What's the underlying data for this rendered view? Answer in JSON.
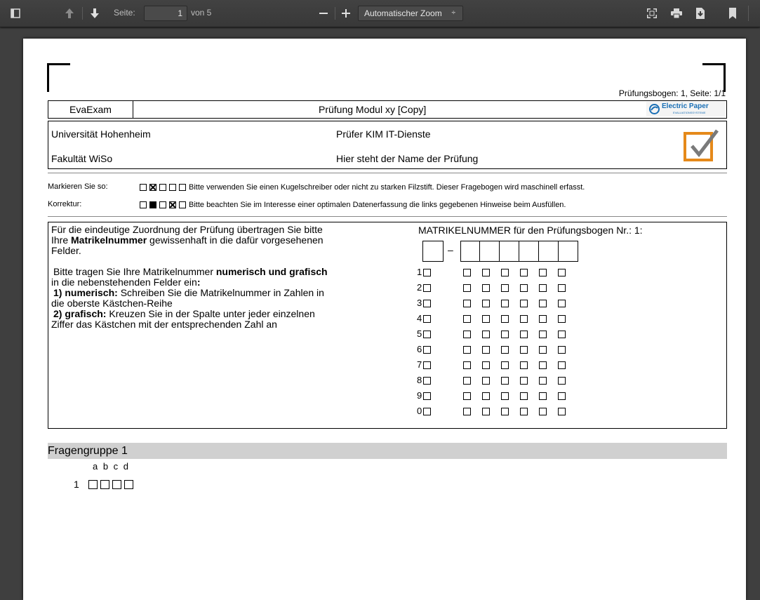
{
  "toolbar": {
    "page_label": "Seite:",
    "page_value": "1",
    "page_of": "von 5",
    "zoom_label": "Automatischer Zoom",
    "zoom_arrow": "÷"
  },
  "sheet": {
    "header_right": "Prüfungsbogen: 1, Seite: 1/1",
    "app_name": "EvaExam",
    "exam_title": "Prüfung Modul xy [Copy]",
    "brand": "Electric Paper",
    "brand_sub": "EVALUATIONSSYSTEME",
    "university": "Universität Hohenheim",
    "examiner": "Prüfer KIM IT-Dienste",
    "faculty": "Fakultät WiSo",
    "exam_name": "Hier steht der Name der Prüfung",
    "mark_label": "Markieren Sie so:",
    "mark_text": "Bitte verwenden Sie einen Kugelschreiber oder nicht zu starken Filzstift. Dieser Fragebogen wird maschinell erfasst.",
    "correction_label": "Korrektur:",
    "correction_text": "Bitte beachten Sie im Interesse einer optimalen Datenerfassung die links gegebenen Hinweise beim Ausfüllen.",
    "instr_p1_a": "Für die eindeutige Zuordnung der Prüfung übertragen Sie bitte",
    "instr_p1_b_pre": "Ihre ",
    "instr_p1_b_bold": "Matrikelnummer",
    "instr_p1_b_post": " gewissenhaft in die dafür vorgesehenen",
    "instr_p1_c": "Felder.",
    "instr_p2_a_pre": "Bitte tragen Sie Ihre Matrikelnummer ",
    "instr_p2_a_bold": "numerisch und grafisch",
    "instr_p2_b_pre": "in die nebenstehenden Felder ein",
    "instr_p2_b_bold": ":",
    "instr_p3_a_bold": "1) numerisch:",
    "instr_p3_a_post": " Schreiben Sie die Matrikelnummer in Zahlen in",
    "instr_p3_b": "die oberste Kästchen-Reihe",
    "instr_p4_a_bold": "2) grafisch:",
    "instr_p4_a_post": " Kreuzen Sie in der Spalte unter jeder einzelnen",
    "instr_p4_b": "Ziffer das Kästchen mit der entsprechenden Zahl an",
    "matrikel_title": "MATRIKELNUMMER für den Prüfungsbogen Nr.: 1:",
    "matrikel_dash": "–",
    "digits": [
      "1",
      "2",
      "3",
      "4",
      "5",
      "6",
      "7",
      "8",
      "9",
      "0"
    ],
    "group_title": "Fragengruppe 1",
    "answer_letters": "a b c d",
    "question_number": "1"
  },
  "colors": {
    "toolbar_bg": "#3b3b3b",
    "viewer_bg": "#3f3f3f",
    "group_bar": "#d0d0d0",
    "brand_blue": "#1a6fb5",
    "check_orange": "#e5891a"
  }
}
